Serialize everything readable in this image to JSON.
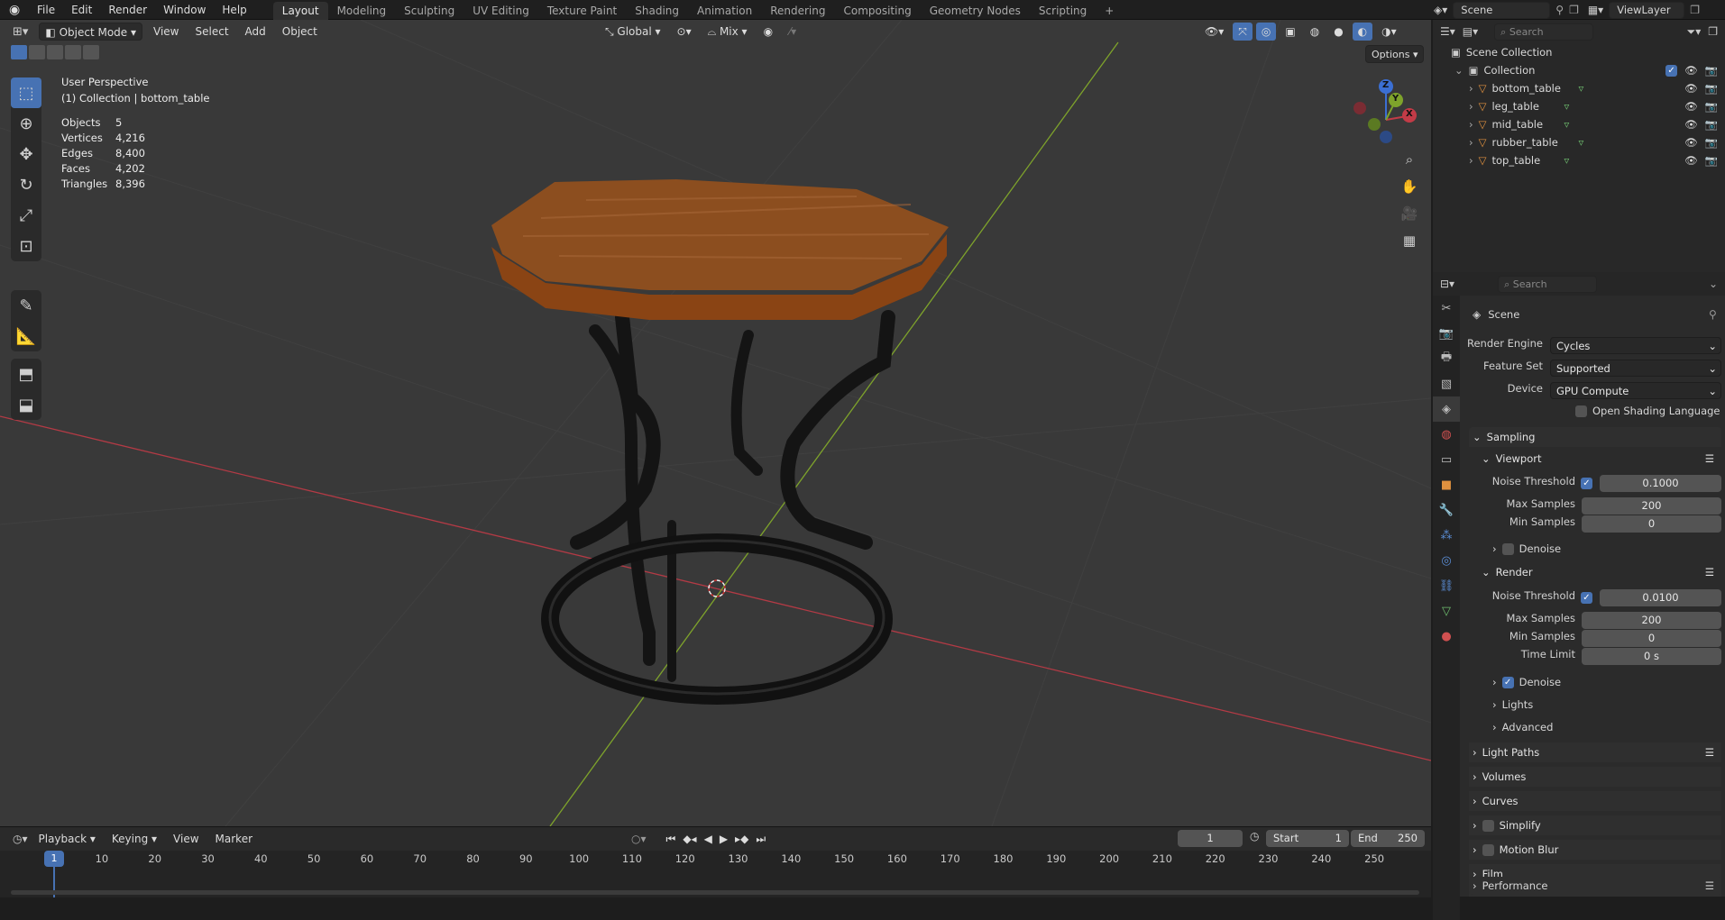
{
  "topbar": {
    "menus": [
      "File",
      "Edit",
      "Render",
      "Window",
      "Help"
    ],
    "workspaces": [
      "Layout",
      "Modeling",
      "Sculpting",
      "UV Editing",
      "Texture Paint",
      "Shading",
      "Animation",
      "Rendering",
      "Compositing",
      "Geometry Nodes",
      "Scripting"
    ],
    "active_workspace": "Layout",
    "add_tab": "+",
    "scene_name": "Scene",
    "view_layer": "ViewLayer"
  },
  "viewport": {
    "mode": "Object Mode",
    "menus": [
      "View",
      "Select",
      "Add",
      "Object"
    ],
    "transform_orientation": "Global",
    "snap_mode": "Mix",
    "options_label": "Options",
    "view_name": "User Perspective",
    "collection_line": "(1) Collection | bottom_table",
    "stats": [
      {
        "label": "Objects",
        "value": "5"
      },
      {
        "label": "Vertices",
        "value": "4,216"
      },
      {
        "label": "Edges",
        "value": "8,400"
      },
      {
        "label": "Faces",
        "value": "4,202"
      },
      {
        "label": "Triangles",
        "value": "8,396"
      }
    ],
    "gizmo": {
      "x": "X",
      "y": "Y",
      "z": "Z"
    },
    "colors": {
      "background": "#393939",
      "x_axis": "#c33b47",
      "y_axis": "#7ea32b",
      "active_tool": "#4772b3"
    }
  },
  "outliner": {
    "search_placeholder": "Search",
    "root": "Scene Collection",
    "collection": "Collection",
    "objects": [
      "bottom_table",
      "leg_table",
      "mid_table",
      "rubber_table",
      "top_table"
    ]
  },
  "properties": {
    "search_placeholder": "Search",
    "context": "Scene",
    "render_engine_label": "Render Engine",
    "render_engine": "Cycles",
    "feature_set_label": "Feature Set",
    "feature_set": "Supported",
    "device_label": "Device",
    "device": "GPU Compute",
    "osl_label": "Open Shading Language",
    "sampling": "Sampling",
    "viewport_panel": "Viewport",
    "vp_noise_label": "Noise Threshold",
    "vp_noise": "0.1000",
    "vp_max_label": "Max Samples",
    "vp_max": "200",
    "vp_min_label": "Min Samples",
    "vp_min": "0",
    "vp_denoise": "Denoise",
    "render_panel": "Render",
    "r_noise_label": "Noise Threshold",
    "r_noise": "0.0100",
    "r_max_label": "Max Samples",
    "r_max": "200",
    "r_min_label": "Min Samples",
    "r_min": "0",
    "r_time_label": "Time Limit",
    "r_time": "0 s",
    "r_denoise": "Denoise",
    "lights": "Lights",
    "advanced": "Advanced",
    "panels": [
      "Light Paths",
      "Volumes",
      "Curves",
      "Simplify",
      "Motion Blur",
      "Film",
      "Performance"
    ]
  },
  "timeline": {
    "menus": [
      "Playback",
      "Keying",
      "View",
      "Marker"
    ],
    "current_frame": "1",
    "start_label": "Start",
    "start": "1",
    "end_label": "End",
    "end": "250",
    "ruler": [
      "1",
      "10",
      "20",
      "30",
      "40",
      "50",
      "60",
      "70",
      "80",
      "90",
      "100",
      "110",
      "120",
      "130",
      "140",
      "150",
      "160",
      "170",
      "180",
      "190",
      "200",
      "210",
      "220",
      "230",
      "240",
      "250"
    ]
  }
}
